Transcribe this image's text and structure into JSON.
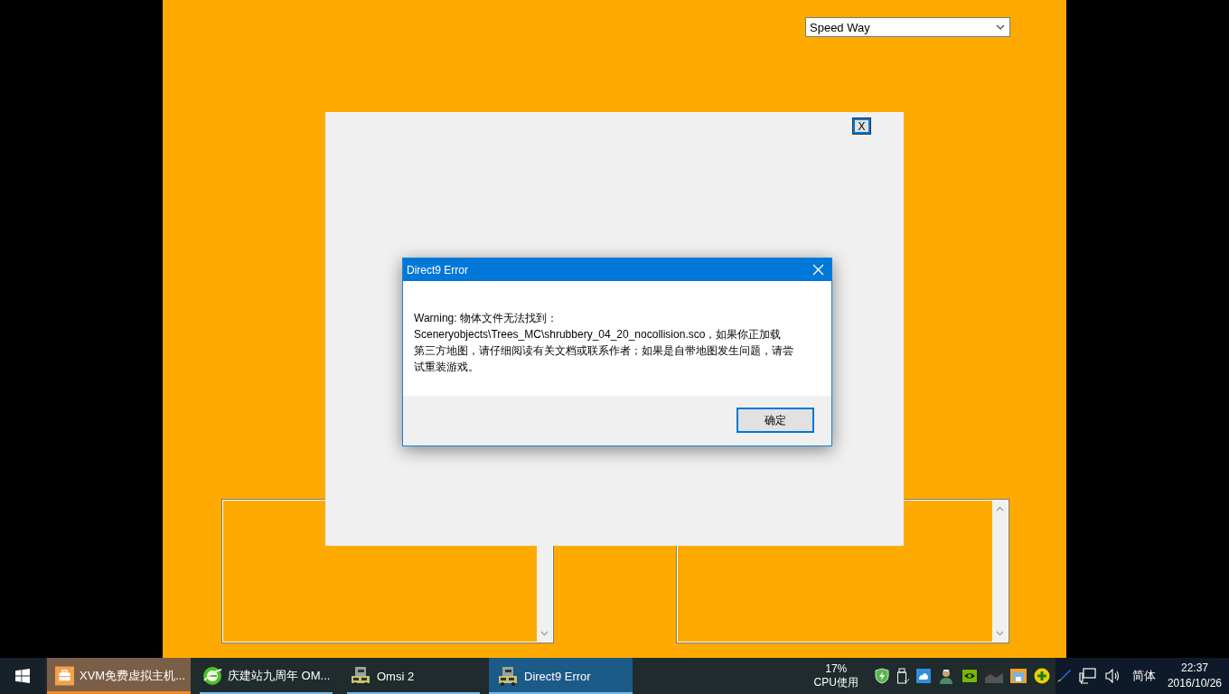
{
  "dropdown": {
    "value": "Speed Way"
  },
  "panel": {
    "close_label": "X"
  },
  "dialog": {
    "title": "Direct9 Error",
    "message_lines": [
      "Warning: 物体文件无法找到：",
      "Sceneryobjects\\Trees_MC\\shrubbery_04_20_nocollision.sco，如果你正加载",
      "第三方地图，请仔细阅读有关文档或联系作者；如果是自带地图发生问题，请尝",
      "试重装游戏。"
    ],
    "ok_button": "确定"
  },
  "taskbar": {
    "tasks": [
      {
        "label": "XVM免费虚拟主机...",
        "kind": "briefcase",
        "selected": false,
        "flashing": true
      },
      {
        "label": "庆建站九周年 OM...",
        "kind": "globe",
        "selected": false,
        "flashing": false
      },
      {
        "label": "Omsi 2",
        "kind": "bus",
        "selected": false,
        "flashing": false
      },
      {
        "label": "Direct9 Error",
        "kind": "bus",
        "selected": true,
        "flashing": false
      }
    ],
    "cpu_percent": "17%",
    "cpu_label": "CPU使用",
    "language": "简体",
    "time": "22:37",
    "date": "2016/10/26"
  }
}
